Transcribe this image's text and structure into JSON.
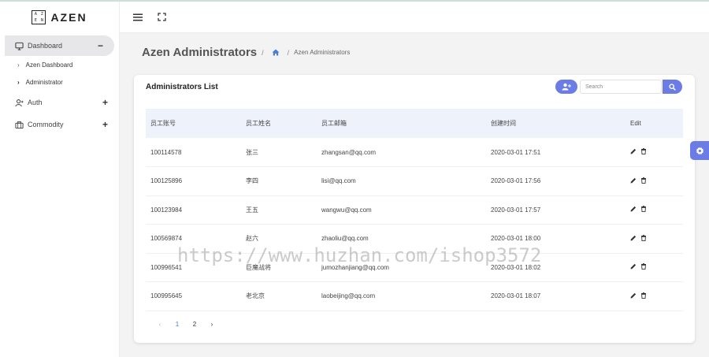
{
  "brand": {
    "mark": [
      "A",
      "Z",
      "E",
      "N"
    ],
    "name": "AZEN"
  },
  "sidebar": {
    "items": [
      {
        "label": "Dashboard",
        "toggle": "−",
        "icon": "monitor-icon"
      },
      {
        "label": "Auth",
        "toggle": "+",
        "icon": "user-icon"
      },
      {
        "label": "Commodity",
        "toggle": "+",
        "icon": "briefcase-icon"
      }
    ],
    "sub_items": [
      {
        "label": "Azen Dashboard"
      },
      {
        "label": "Administrator"
      }
    ]
  },
  "header": {
    "icons": [
      "menu-icon",
      "fullscreen-icon"
    ]
  },
  "page": {
    "title": "Azen Administrators",
    "breadcrumb_sep": "/",
    "breadcrumb_current": "Azen Administrators"
  },
  "card": {
    "title": "Administrators List",
    "search_placeholder": "Search"
  },
  "table": {
    "headers": [
      "员工账号",
      "员工姓名",
      "员工邮箱",
      "创建时间",
      "Edit"
    ],
    "rows": [
      [
        "100114578",
        "张三",
        "zhangsan@qq.com",
        "2020-03-01 17:51"
      ],
      [
        "100125896",
        "李四",
        "lisi@qq.com",
        "2020-03-01 17:56"
      ],
      [
        "100123984",
        "王五",
        "wangwu@qq.com",
        "2020-03-01 17:57"
      ],
      [
        "100569874",
        "赵六",
        "zhaoliu@qq.com",
        "2020-03-01 18:00"
      ],
      [
        "100996541",
        "巨魔战将",
        "jumozhanjiang@qq.com",
        "2020-03-01 18:02"
      ],
      [
        "100995645",
        "老北京",
        "laobeijing@qq.com",
        "2020-03-01 18:07"
      ]
    ]
  },
  "pagination": {
    "prev": "‹",
    "pages": [
      "1",
      "2"
    ],
    "next": "›",
    "current": "1"
  },
  "watermark": "https://www.huzhan.com/ishop3572",
  "colors": {
    "accent": "#6b7ce6",
    "header_row": "#eef2fb",
    "active_page": "#4a7fd1"
  }
}
